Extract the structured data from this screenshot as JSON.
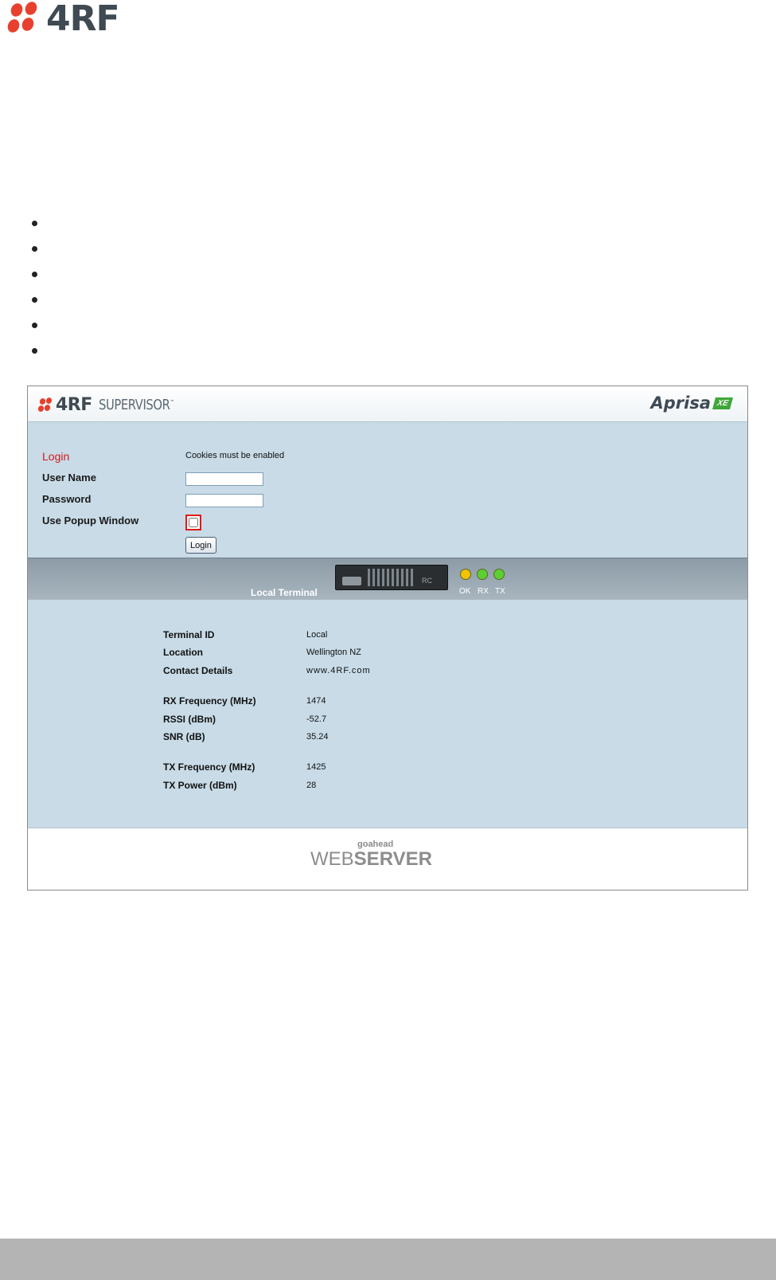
{
  "page": {
    "logo_text": "4RF",
    "bullet_count": 6
  },
  "app": {
    "brand": "4RF",
    "product": "SUPERVISOR",
    "trademark": "™",
    "right_logo": "Aprisa",
    "right_badge": "XE"
  },
  "login": {
    "title": "Login",
    "cookies_note": "Cookies must be enabled",
    "username_label": "User Name",
    "username_value": "",
    "password_label": "Password",
    "password_value": "",
    "popup_label": "Use Popup Window",
    "popup_checked": false,
    "button_label": "Login"
  },
  "terminal": {
    "label": "Local Terminal",
    "device_tag": "RC",
    "leds": [
      {
        "label": "OK",
        "color": "#f2c200"
      },
      {
        "label": "RX",
        "color": "#5bd033"
      },
      {
        "label": "TX",
        "color": "#5bd033"
      }
    ]
  },
  "info": {
    "terminal_id_label": "Terminal ID",
    "terminal_id": "Local",
    "location_label": "Location",
    "location": "Wellington NZ",
    "contact_label": "Contact Details",
    "contact": "www.4RF.com",
    "rx_freq_label": "RX Frequency (MHz)",
    "rx_freq": "1474",
    "rssi_label": "RSSI (dBm)",
    "rssi": "-52.7",
    "snr_label": "SNR (dB)",
    "snr": "35.24",
    "tx_freq_label": "TX Frequency (MHz)",
    "tx_freq": "1425",
    "tx_power_label": "TX Power (dBm)",
    "tx_power": "28"
  },
  "footer": {
    "small": "goahead",
    "web": "WEB",
    "server": "SERVER"
  },
  "colors": {
    "accent_red": "#e8402e",
    "panel": "#c8dbe7",
    "bar": "#9aa8b2"
  }
}
